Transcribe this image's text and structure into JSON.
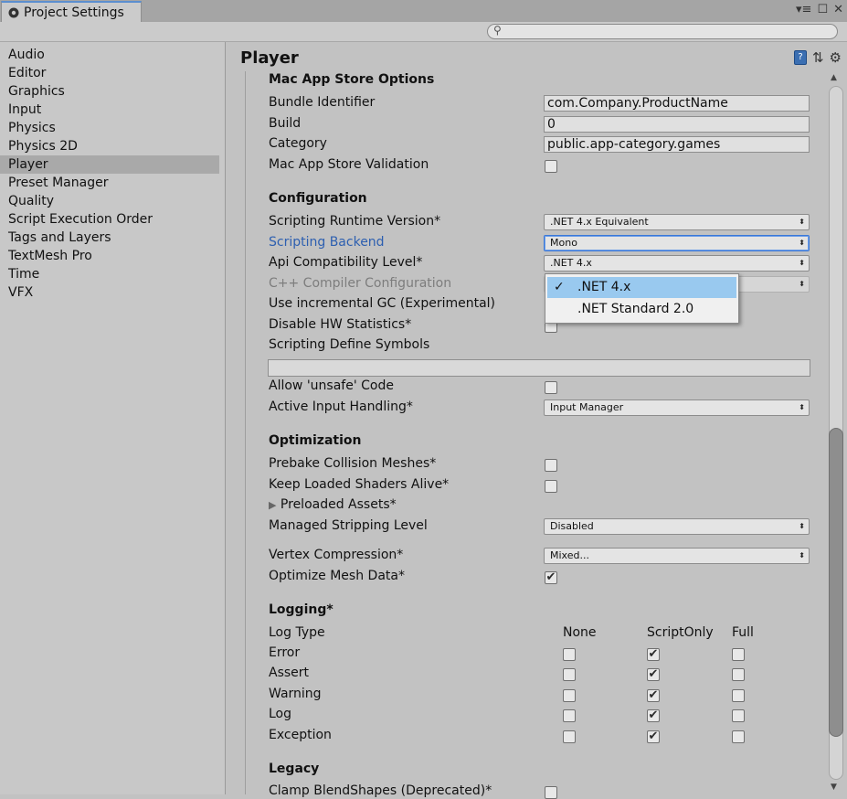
{
  "window": {
    "tab_title": "Project Settings",
    "tab_icon": "gear-icon"
  },
  "search": {
    "placeholder": ""
  },
  "sidebar": {
    "items": [
      {
        "label": "Audio"
      },
      {
        "label": "Editor"
      },
      {
        "label": "Graphics"
      },
      {
        "label": "Input"
      },
      {
        "label": "Physics"
      },
      {
        "label": "Physics 2D"
      },
      {
        "label": "Player",
        "selected": true
      },
      {
        "label": "Preset Manager"
      },
      {
        "label": "Quality"
      },
      {
        "label": "Script Execution Order"
      },
      {
        "label": "Tags and Layers"
      },
      {
        "label": "TextMesh Pro"
      },
      {
        "label": "Time"
      },
      {
        "label": "VFX"
      }
    ]
  },
  "main": {
    "title": "Player",
    "mac_store": {
      "heading": "Mac App Store Options",
      "bundle_identifier_label": "Bundle Identifier",
      "bundle_identifier_value": "com.Company.ProductName",
      "build_label": "Build",
      "build_value": "0",
      "category_label": "Category",
      "category_value": "public.app-category.games",
      "validation_label": "Mac App Store Validation",
      "validation_checked": false
    },
    "configuration": {
      "heading": "Configuration",
      "runtime_label": "Scripting Runtime Version*",
      "runtime_value": ".NET 4.x Equivalent",
      "backend_label": "Scripting Backend",
      "backend_value": "Mono",
      "api_label": "Api Compatibility Level*",
      "api_value": ".NET 4.x",
      "cpp_label": "C++ Compiler Configuration",
      "incremental_gc_label": "Use incremental GC (Experimental)",
      "hw_stats_label": "Disable HW Statistics*",
      "define_symbols_label": "Scripting Define Symbols",
      "define_symbols_value": "",
      "unsafe_label": "Allow 'unsafe' Code",
      "unsafe_checked": false,
      "input_handling_label": "Active Input Handling*",
      "input_handling_value": "Input Manager"
    },
    "api_popup": {
      "options": [
        {
          "label": ".NET 4.x",
          "selected": true
        },
        {
          "label": ".NET Standard 2.0",
          "selected": false
        }
      ]
    },
    "optimization": {
      "heading": "Optimization",
      "prebake_label": "Prebake Collision Meshes*",
      "prebake_checked": false,
      "keep_shaders_label": "Keep Loaded Shaders Alive*",
      "keep_shaders_checked": false,
      "preloaded_label": "Preloaded Assets*",
      "stripping_label": "Managed Stripping Level",
      "stripping_value": "Disabled",
      "vertex_label": "Vertex Compression*",
      "vertex_value": "Mixed...",
      "optimize_mesh_label": "Optimize Mesh Data*",
      "optimize_mesh_checked": true
    },
    "logging": {
      "heading": "Logging*",
      "log_type_label": "Log Type",
      "col_none": "None",
      "col_scriptonly": "ScriptOnly",
      "col_full": "Full",
      "rows": [
        {
          "label": "Error",
          "value": "ScriptOnly"
        },
        {
          "label": "Assert",
          "value": "ScriptOnly"
        },
        {
          "label": "Warning",
          "value": "ScriptOnly"
        },
        {
          "label": "Log",
          "value": "ScriptOnly"
        },
        {
          "label": "Exception",
          "value": "ScriptOnly"
        }
      ]
    },
    "legacy": {
      "heading": "Legacy",
      "clamp_label": "Clamp BlendShapes (Deprecated)*"
    }
  },
  "colors": {
    "link_blue": "#2d5fb0",
    "popup_selected": "#99c9ef",
    "selected_sidebar": "#a9a9a9"
  }
}
